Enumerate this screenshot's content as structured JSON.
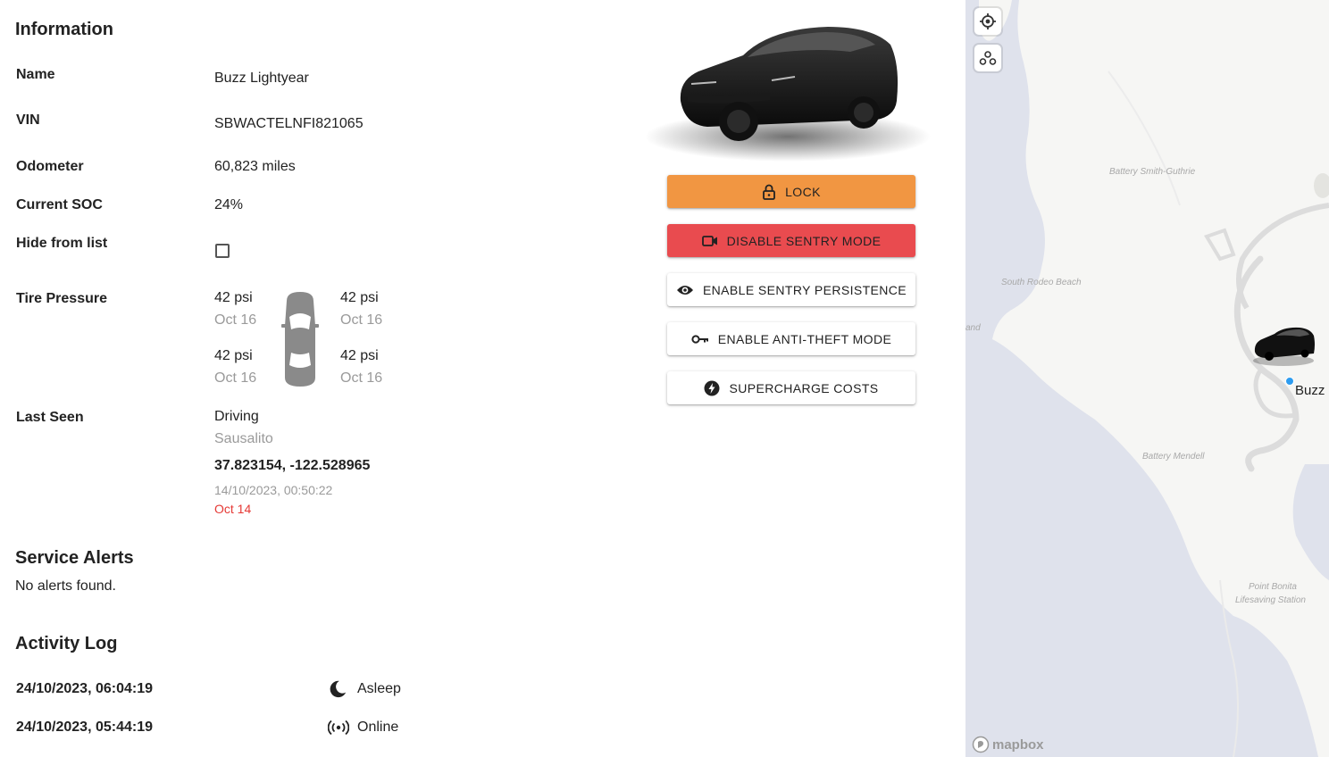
{
  "info": {
    "heading": "Information",
    "name_label": "Name",
    "name": "Buzz Lightyear",
    "vin_label": "VIN",
    "vin": "SBWACTELNFI821065",
    "odometer_label": "Odometer",
    "odometer": "60,823 miles",
    "soc_label": "Current SOC",
    "soc": "24%",
    "hide_label": "Hide from list",
    "hide_checked": false
  },
  "tires": {
    "label": "Tire Pressure",
    "front_left": {
      "psi": "42 psi",
      "date": "Oct 16"
    },
    "front_right": {
      "psi": "42 psi",
      "date": "Oct 16"
    },
    "rear_left": {
      "psi": "42 psi",
      "date": "Oct 16"
    },
    "rear_right": {
      "psi": "42 psi",
      "date": "Oct 16"
    }
  },
  "last_seen": {
    "label": "Last Seen",
    "status": "Driving",
    "place": "Sausalito",
    "coords": "37.823154, -122.528965",
    "timestamp": "14/10/2023, 00:50:22",
    "relative": "Oct 14"
  },
  "service_alerts": {
    "heading": "Service Alerts",
    "message": "No alerts found."
  },
  "activity_log": {
    "heading": "Activity Log",
    "entries": [
      {
        "time": "24/10/2023, 06:04:19",
        "icon": "moon-icon",
        "state": "Asleep"
      },
      {
        "time": "24/10/2023, 05:44:19",
        "icon": "broadcast-icon",
        "state": "Online"
      }
    ]
  },
  "actions": {
    "lock": "LOCK",
    "disable_sentry": "DISABLE SENTRY MODE",
    "enable_persistence": "ENABLE SENTRY PERSISTENCE",
    "enable_antitheft": "ENABLE ANTI-THEFT MODE",
    "supercharge": "SUPERCHARGE COSTS"
  },
  "colors": {
    "lock": "#f19642",
    "sentry": "#e94b4f",
    "expired": "#e53935",
    "location_dot": "#2d9cf0"
  },
  "map": {
    "labels": {
      "smith": "Battery Smith-Guthrie",
      "rodeo": "South Rodeo Beach",
      "mendell": "Battery Mendell",
      "bonita": "Point Bonita",
      "lifesaving": "Lifesaving Station",
      "land": "and"
    },
    "vehicle_label": "Buzz",
    "attribution": "mapbox"
  }
}
